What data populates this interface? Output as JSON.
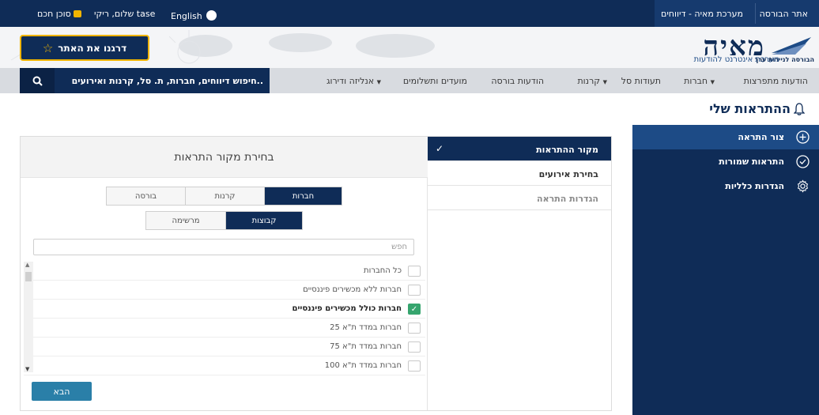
{
  "topbar": {
    "tase_site": "אתר הבורסה",
    "maya_reports": "מערכת מאיה - דיווחים",
    "english": "English",
    "greeting": "שלום, ריקי tase",
    "secure_agent": "סוכן חכם"
  },
  "header": {
    "logo": "מאיה",
    "logo_subtitle": "מערכת אינטרנט להודעות",
    "tase_name": "הבורסה לניירות ערך",
    "tour_button": "דרגנו את האתר"
  },
  "nav": {
    "items": [
      "הודעות מתפרצות",
      "חברות",
      "תעודות סל",
      "קרנות",
      "הודעות בורסה",
      "מועדים ותשלומים",
      "אנליזה ודירוג"
    ],
    "search_placeholder": "חיפוש דיווחים, חברות, ת. סל, קרנות ואירועים.."
  },
  "page_title": "ההתראות שלי",
  "sidebar": {
    "items": [
      {
        "label": "צור התראה",
        "icon": "plus-circle-icon"
      },
      {
        "label": "התראות שמורות",
        "icon": "check-circle-icon"
      },
      {
        "label": "הגדרות כלליות",
        "icon": "gear-icon"
      }
    ]
  },
  "wizard": {
    "steps": [
      "מקור ההתראות",
      "בחירת אירועים",
      "הגדרות התראה"
    ],
    "panel_title": "בחירת מקור התראות",
    "source_tabs": [
      "חברות",
      "קרנות",
      "בורסה"
    ],
    "mode_tabs": [
      "קבוצות",
      "מרשימה"
    ],
    "search_placeholder": "חפש",
    "list": [
      {
        "label": "כל החברות",
        "checked": false
      },
      {
        "label": "חברות ללא מכשירים פיננסיים",
        "checked": false
      },
      {
        "label": "חברות כולל מכשירים פיננסיים",
        "checked": true
      },
      {
        "label": "חברות במדד ת\"א 25",
        "checked": false
      },
      {
        "label": "חברות במדד ת\"א 75",
        "checked": false
      },
      {
        "label": "חברות במדד ת\"א 100",
        "checked": false
      }
    ],
    "next_button": "הבא"
  }
}
